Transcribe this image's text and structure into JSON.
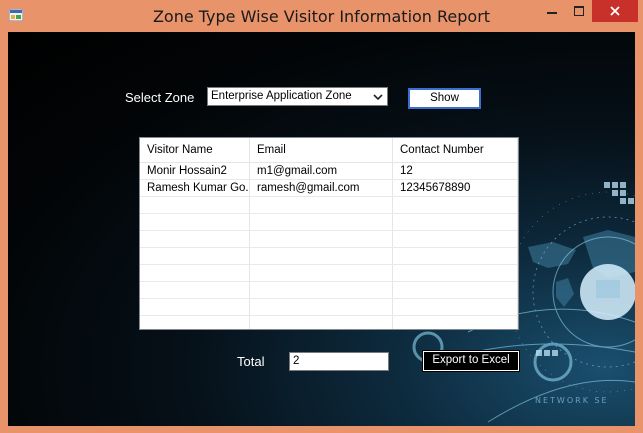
{
  "window": {
    "title": "Zone Type Wise Visitor Information Report",
    "icons": {
      "app": "app-form-icon",
      "minimize": "minimize-icon",
      "maximize": "maximize-icon",
      "close": "close-icon"
    },
    "colors": {
      "frame": "#e8936a",
      "close": "#c7312a",
      "client_bg": "#000000",
      "accent": "#3a6fd0"
    }
  },
  "filter": {
    "label": "Select Zone",
    "selected": "Enterprise Application Zone",
    "dropdown_icon": "chevron-down-icon",
    "show_label": "Show"
  },
  "grid": {
    "columns": [
      "Visitor Name",
      "Email",
      "Contact Number"
    ],
    "rows": [
      [
        "Monir Hossain2",
        "m1@gmail.com",
        "12"
      ],
      [
        "Ramesh Kumar Go...",
        "ramesh@gmail.com",
        "12345678890"
      ]
    ]
  },
  "footer": {
    "total_label": "Total",
    "total_value": "2",
    "export_label": "Export to Excel"
  },
  "background": {
    "watermark": "NETWORK SE"
  }
}
